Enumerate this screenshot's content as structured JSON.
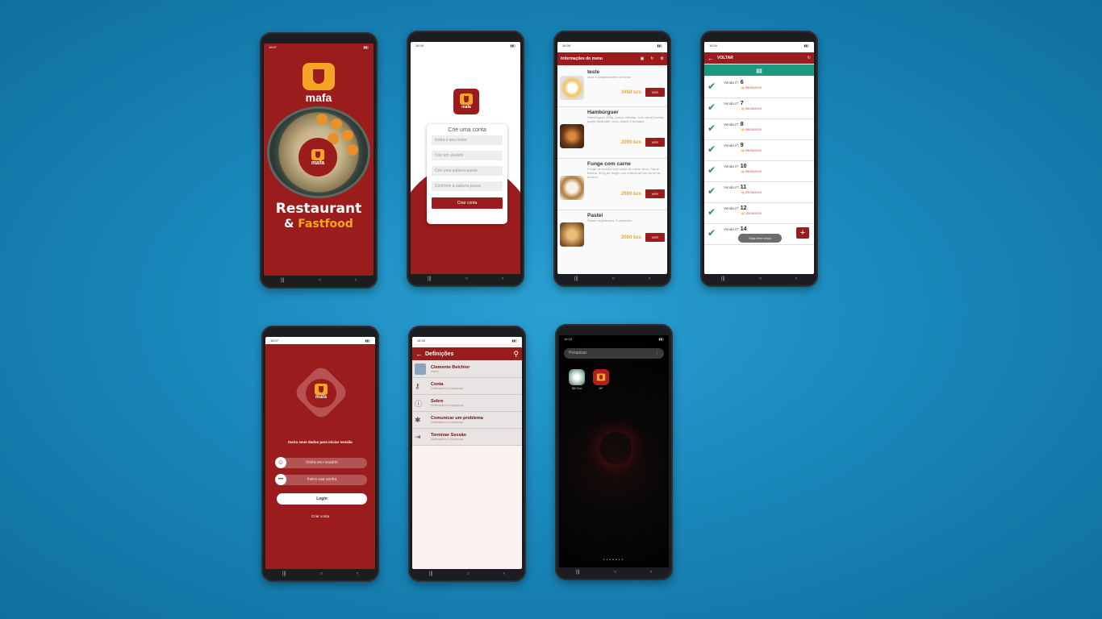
{
  "phone1": {
    "status_time": "16:07",
    "brand": "mafa",
    "title_line1": "Restaurant",
    "title_amp": "&",
    "title_line2": "Fastfood"
  },
  "phone2": {
    "status_time": "16:39",
    "brand": "mafa",
    "form_title": "Crie uma conta",
    "fields": [
      "Insira o seu nome",
      "Crie um usuário",
      "Crie uma palavra passe",
      "Confirme a palavra passe"
    ],
    "submit": "Criar conta"
  },
  "phone3": {
    "header": "Informações do menu",
    "items": [
      {
        "name": "teste",
        "desc": "esse é simplesmente um teste",
        "price": "3450 kzs",
        "button": "VER"
      },
      {
        "name": "Hambúrguer",
        "desc": "Hambúrguer 500g, pouco cebolas, com carne bovina, queijo holandês, ovos, alface e tomates.",
        "price": "2000 kzs",
        "button": "VER"
      },
      {
        "name": "Funge com carne",
        "desc": "Funge de bombó com caldo de carne seca. Carne bovina, 300g de funge com chikela de um surne de musico.",
        "price": "2500 kzs",
        "button": "VER"
      },
      {
        "name": "Pastel",
        "desc": "Pastel vegetariano, 5 unidades.",
        "price": "2000 kzs",
        "button": "VER"
      }
    ]
  },
  "phone4": {
    "status_time": "16:29",
    "back_label": "VOLTAR",
    "sales": [
      {
        "label": "Venda nº:",
        "num": "6",
        "date": "08/05/2024"
      },
      {
        "label": "Venda nº:",
        "num": "7",
        "date": "08/05/2024"
      },
      {
        "label": "Venda nº:",
        "num": "8",
        "date": "08/05/2024"
      },
      {
        "label": "Venda nº:",
        "num": "9",
        "date": "08/05/2024"
      },
      {
        "label": "Venda nº:",
        "num": "10",
        "date": "08/05/2024"
      },
      {
        "label": "Venda nº:",
        "num": "11",
        "date": "09/05/2024"
      },
      {
        "label": "Venda nº:",
        "num": "12",
        "date": "10/05/2024"
      },
      {
        "label": "Venda nº:",
        "num": "14",
        "date": ""
      }
    ],
    "toast": "Seja bem vindo"
  },
  "phone5": {
    "status_time": "16:07",
    "brand": "mafa",
    "prompt": "Insira seus dados para iniciar sessão",
    "user_placeholder": "Insira seu usuário",
    "pass_placeholder": "Insira sua senha",
    "login": "Login",
    "create": "Criar conta"
  },
  "phone6": {
    "status_time": "16:35",
    "title": "Definições",
    "rows": [
      {
        "title": "Clemente Belchior",
        "sub": "Admin"
      },
      {
        "title": "Conta",
        "sub": "Notificações & Segurança"
      },
      {
        "title": "Sobre",
        "sub": "Notificações & Segurança"
      },
      {
        "title": "Comunicar um problema",
        "sub": "Notificações & Segurança"
      },
      {
        "title": "Terminar Sessão",
        "sub": "Notificações & Segurança"
      }
    ]
  },
  "phone7": {
    "status_time": "16:16",
    "search": "Pesquisar",
    "apps": [
      {
        "label": "360 Zoo"
      },
      {
        "label": "MF"
      }
    ]
  }
}
